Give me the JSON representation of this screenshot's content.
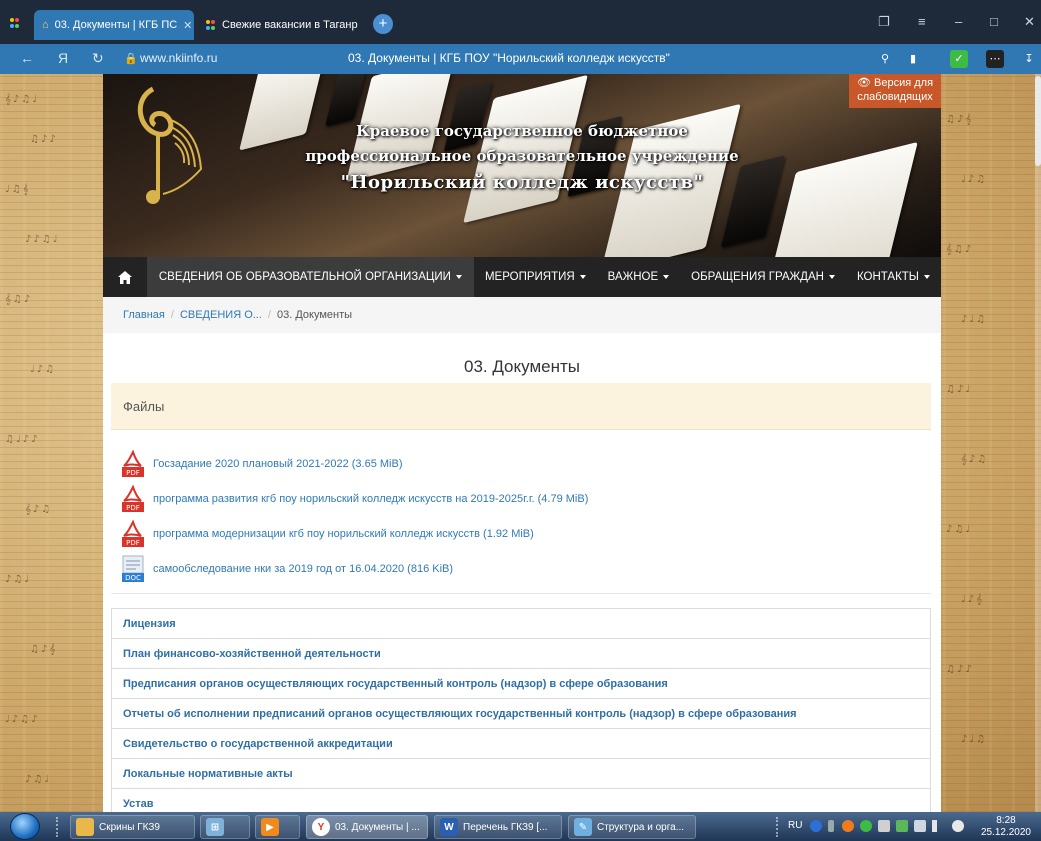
{
  "browser": {
    "tabs": [
      {
        "title": "03. Документы | КГБ ПС",
        "active": true
      },
      {
        "title": "Свежие вакансии в Таганр",
        "active": false
      }
    ],
    "address": "www.nkiinfo.ru",
    "page_title": "03. Документы | КГБ ПОУ \"Норильский колледж искусств\""
  },
  "header": {
    "line1": "Краевое государственное бюджетное",
    "line2": "профессиональное образовательное учреждение",
    "line3": "\"Норильский колледж искусств\"",
    "low_vision_label": "Версия для слабовидящих"
  },
  "nav": {
    "items": [
      {
        "label": "СВЕДЕНИЯ ОБ ОБРАЗОВАТЕЛЬНОЙ ОРГАНИЗАЦИИ"
      },
      {
        "label": "МЕРОПРИЯТИЯ"
      },
      {
        "label": "ВАЖНОЕ"
      },
      {
        "label": "ОБРАЩЕНИЯ ГРАЖДАН"
      },
      {
        "label": "КОНТАКТЫ"
      }
    ]
  },
  "breadcrumb": {
    "home": "Главная",
    "section": "СВЕДЕНИЯ О...",
    "current": "03. Документы"
  },
  "page": {
    "heading": "03. Документы",
    "files_panel_title": "Файлы"
  },
  "files": [
    {
      "name": "Госзадание 2020 плановый 2021-2022 (3.65 MiB)",
      "type": "PDF"
    },
    {
      "name": "программа развития кгб поу норильский колледж искусств на 2019-2025г.г. (4.79 MiB)",
      "type": "PDF"
    },
    {
      "name": "программа модернизации кгб поу норильский колледж искусств (1.92 MiB)",
      "type": "PDF"
    },
    {
      "name": "самообследование нки за 2019 год от 16.04.2020 (816 KiB)",
      "type": "DOC"
    }
  ],
  "accordion": [
    "Лицензия",
    "План финансово-хозяйственной деятельности",
    "Предписания органов осуществляющих государственный контроль (надзор) в сфере образования",
    "Отчеты об исполнении предписаний органов осуществляющих государственный контроль (надзор) в сфере образования",
    "Свидетельство о государственной аккредитации",
    "Локальные нормативные акты",
    "Устав"
  ],
  "taskbar": {
    "items": [
      {
        "label": "Скрины ГКЗ9"
      },
      {
        "label": ""
      },
      {
        "label": ""
      },
      {
        "label": "03. Документы | ..."
      },
      {
        "label": "Перечень ГКЗ9 [..."
      },
      {
        "label": "Структура и орга..."
      }
    ],
    "lang": "RU",
    "time": "8:28",
    "date": "25.12.2020"
  },
  "colors": {
    "browser_blue": "#2f78b4",
    "link": "#2f7ab8",
    "navbar": "#232323",
    "low_vision_button": "#c8582a",
    "files_panel": "#fbf3dd"
  }
}
